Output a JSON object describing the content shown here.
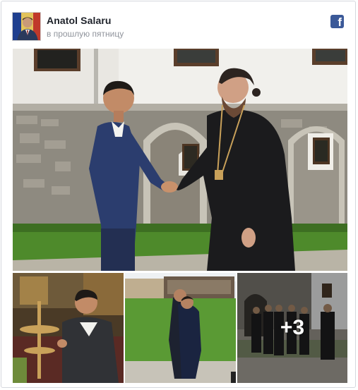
{
  "post": {
    "author": "Anatol Salaru",
    "timestamp": "в прошлую пятницу",
    "more_count": "+3"
  },
  "icons": {
    "platform": "facebook-icon"
  },
  "colors": {
    "facebook_blue": "#3b5998",
    "name_text": "#1d2129",
    "meta_text": "#90949c"
  }
}
